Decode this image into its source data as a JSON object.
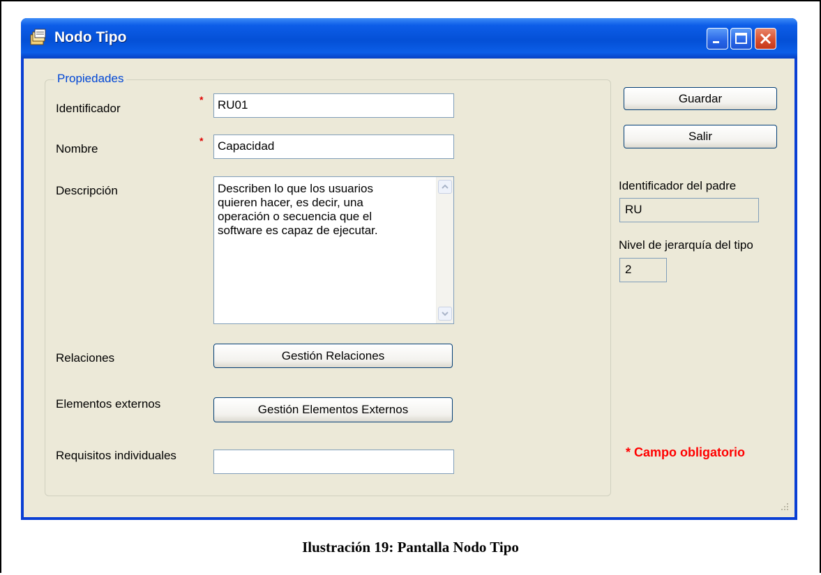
{
  "window": {
    "title": "Nodo Tipo",
    "icon": "folder-stack-icon",
    "controls": [
      "minimize-icon",
      "maximize-icon",
      "close-icon"
    ]
  },
  "group": {
    "legend": "Propiedades"
  },
  "form": {
    "identificador": {
      "label": "Identificador",
      "required_mark": "*",
      "value": "RU01"
    },
    "nombre": {
      "label": "Nombre",
      "required_mark": "*",
      "value": "Capacidad"
    },
    "descripcion": {
      "label": "Descripción",
      "lines": [
        "Describen lo que los usuarios",
        "quieren hacer, es decir, una",
        "operación o secuencia que el",
        "software es capaz de ejecutar."
      ]
    },
    "relaciones": {
      "label": "Relaciones",
      "button": "Gestión Relaciones"
    },
    "elementos_externos": {
      "label": "Elementos externos",
      "button": "Gestión Elementos Externos"
    },
    "requisitos_individuales": {
      "label": "Requisitos individuales",
      "value": ""
    }
  },
  "actions": {
    "guardar": "Guardar",
    "salir": "Salir"
  },
  "side": {
    "padre_label": "Identificador del padre",
    "padre_value": "RU",
    "nivel_label": "Nivel de jerarquía del tipo",
    "nivel_value": "2",
    "mandatory_note": "* Campo obligatorio"
  },
  "caption": "Ilustración 19: Pantalla Nodo Tipo",
  "colors": {
    "titlebar": "#0450d6",
    "window_bg": "#ece9d8",
    "legend": "#0046d5",
    "required": "#ff0000",
    "close_button": "#d9502f"
  }
}
